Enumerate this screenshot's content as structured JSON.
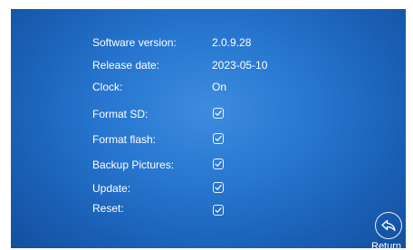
{
  "info": {
    "software_version": {
      "label": "Software version:",
      "value": "2.0.9.28"
    },
    "release_date": {
      "label": "Release date:",
      "value": "2023-05-10"
    },
    "clock": {
      "label": "Clock:",
      "value": "On"
    }
  },
  "options": [
    {
      "label": "Format SD:",
      "checked": true
    },
    {
      "label": "Format flash:",
      "checked": true
    },
    {
      "label": "Backup Pictures:",
      "checked": true
    },
    {
      "label": "Update:",
      "checked": true
    },
    {
      "label": "Reset:",
      "checked": true
    }
  ],
  "footer": {
    "return_label": "Return",
    "return_icon": "return-arrow-icon"
  },
  "colors": {
    "background": "#2776cf",
    "text": "#ffffff"
  }
}
